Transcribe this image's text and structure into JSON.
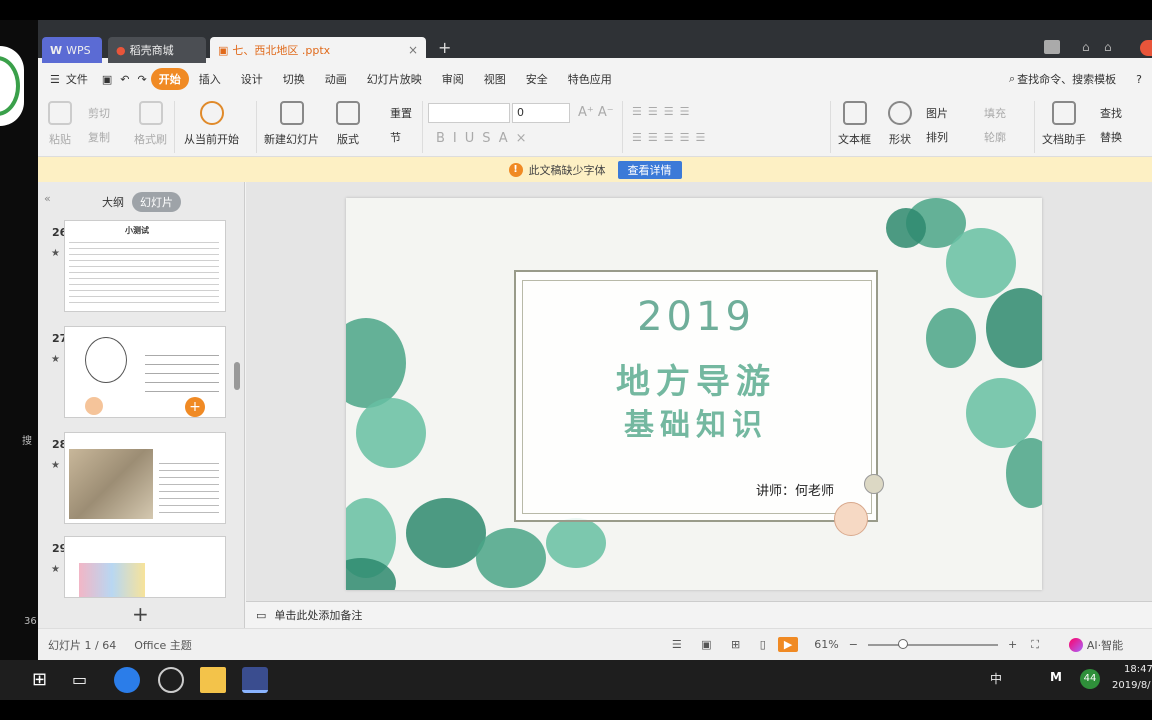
{
  "tabs": {
    "wps": "WPS",
    "store": "稻壳商城",
    "doc": "七、西北地区 .pptx"
  },
  "menu": [
    "文件",
    "开始",
    "插入",
    "设计",
    "切换",
    "动画",
    "幻灯片放映",
    "审阅",
    "视图",
    "安全",
    "特色应用"
  ],
  "search_cmd": "查找命令、搜索模板",
  "ribbon": {
    "paste": "粘贴",
    "cut": "剪切",
    "copy": "复制",
    "format_painter": "格式刷",
    "from_current": "从当前开始",
    "new_slide": "新建幻灯片",
    "layout": "版式",
    "reset": "重置",
    "section": "节",
    "font_size": "0",
    "textbox": "文本框",
    "shape": "形状",
    "picture": "图片",
    "arrange": "排列",
    "fill": "填充",
    "outline": "轮廓",
    "doc_helper": "文档助手",
    "find": "查找",
    "replace": "替换"
  },
  "notice": {
    "text": "此文稿缺少字体",
    "button": "查看详情"
  },
  "panel": {
    "outline": "大纲",
    "slides": "幻灯片",
    "nums": [
      "26",
      "27",
      "28",
      "29"
    ]
  },
  "slide": {
    "year": "2019",
    "title1": "地方导游",
    "title2": "基础知识",
    "lecturer": "讲师：何老师"
  },
  "notes": "单击此处添加备注",
  "status": {
    "slide": "幻灯片 1 / 64",
    "theme": "Office 主题",
    "zoom": "61%",
    "ai": "AI·智能"
  },
  "taskbar": {
    "time": "18:47",
    "date": "2019/8/",
    "tray_lang": "中",
    "tray_badge": "44"
  },
  "desktop": {
    "left1": "搜",
    "left2": "36"
  }
}
